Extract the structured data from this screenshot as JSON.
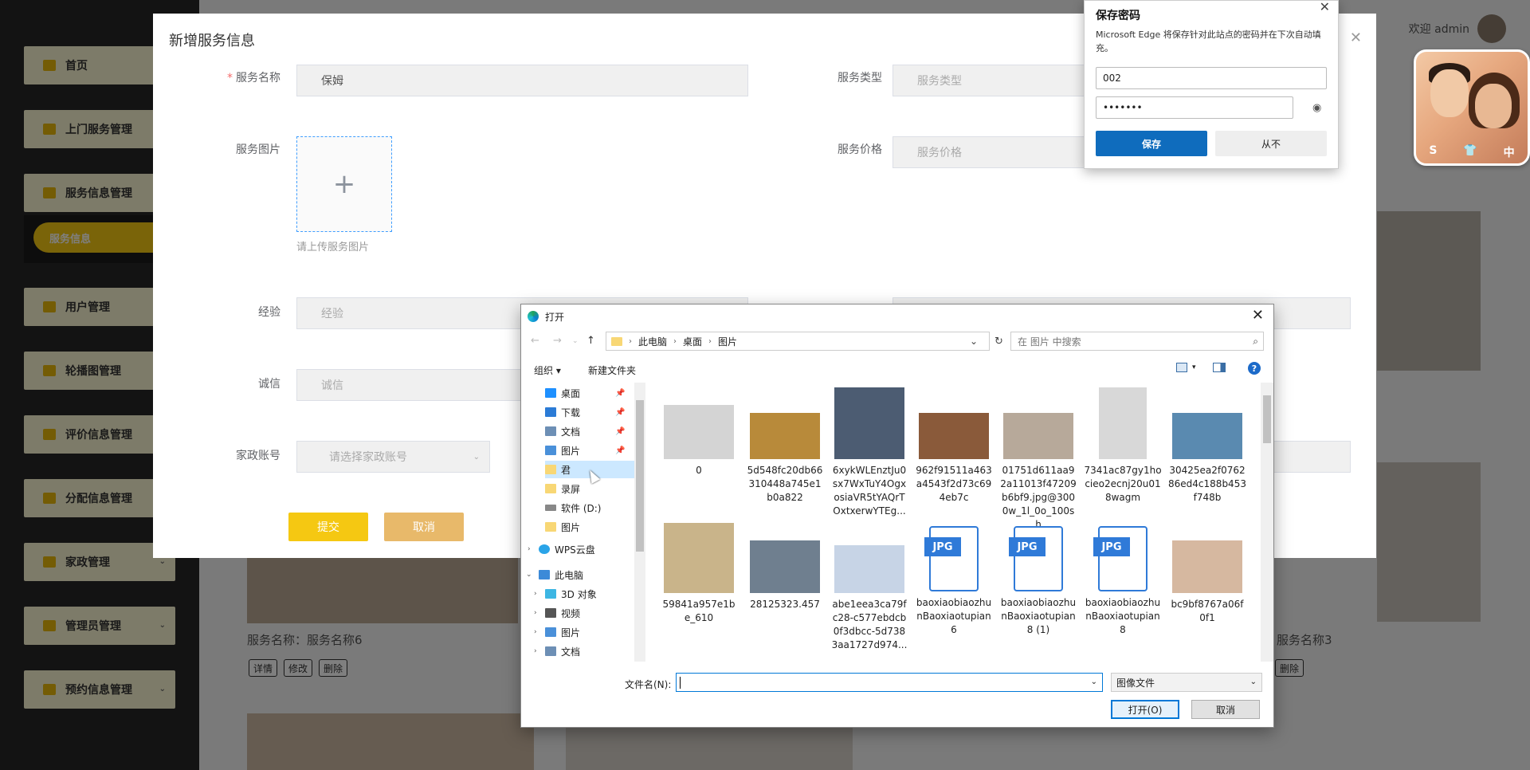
{
  "sidebar": {
    "items": [
      {
        "label": "首页",
        "top": 0
      },
      {
        "label": "上门服务管理"
      },
      {
        "label": "服务信息管理"
      },
      {
        "label": "用户管理"
      },
      {
        "label": "轮播图管理"
      },
      {
        "label": "评价信息管理"
      },
      {
        "label": "分配信息管理"
      },
      {
        "label": "家政管理"
      },
      {
        "label": "管理员管理"
      },
      {
        "label": "预约信息管理"
      }
    ],
    "submenu_active": "服务信息"
  },
  "topbar": {
    "welcome": "欢迎 admin"
  },
  "background_cards": [
    {
      "title": "服务名称：服务名称6",
      "buttons": [
        "详情",
        "修改",
        "删除"
      ]
    },
    {
      "title": "服务名称3",
      "buttons": [
        "删除"
      ]
    }
  ],
  "modal": {
    "title": "新增服务信息",
    "fields": {
      "service_name_label": "服务名称",
      "service_name_value": "保姆",
      "service_type_label": "服务类型",
      "service_type_placeholder": "服务类型",
      "service_image_label": "服务图片",
      "upload_tip": "请上传服务图片",
      "service_price_label": "服务价格",
      "service_price_placeholder": "服务价格",
      "experience_label": "经验",
      "experience_placeholder": "经验",
      "integrity_label": "诚信",
      "integrity_placeholder": "诚信",
      "housekeeping_label": "家政账号",
      "housekeeping_placeholder": "请选择家政账号"
    },
    "submit_label": "提交",
    "cancel_label": "取消"
  },
  "password_popup": {
    "title": "保存密码",
    "description": "Microsoft Edge 将保存针对此站点的密码并在下次自动填充。",
    "username": "002",
    "password_mask": "•••••••",
    "save_label": "保存",
    "never_label": "从不"
  },
  "profile_card": {
    "badges": [
      "S",
      "👕",
      "中"
    ]
  },
  "file_dialog": {
    "title": "打开",
    "breadcrumb": [
      "此电脑",
      "桌面",
      "图片"
    ],
    "search_placeholder": "在 图片 中搜索",
    "toolbar": {
      "organize": "组织 ▾",
      "new_folder": "新建文件夹"
    },
    "tree": [
      {
        "label": "桌面",
        "pinned": true,
        "icon_color": "#1e90ff"
      },
      {
        "label": "下载",
        "pinned": true,
        "icon_color": "#2b7bd6"
      },
      {
        "label": "文档",
        "pinned": true,
        "icon_color": "#6d8fb5"
      },
      {
        "label": "图片",
        "pinned": true,
        "icon_color": "#4a90d9"
      },
      {
        "label": "君",
        "pinned": false,
        "icon_color": "#f8d775"
      },
      {
        "label": "录屏",
        "pinned": false,
        "icon_color": "#f8d775"
      },
      {
        "label": "软件 (D:)",
        "pinned": false,
        "icon_color": "#888888"
      },
      {
        "label": "图片",
        "pinned": false,
        "icon_color": "#f8d775"
      },
      {
        "label": "WPS云盘",
        "pinned": false,
        "icon_color": "#2aa4e8"
      },
      {
        "label": "此电脑",
        "pinned": false,
        "icon_color": "#3c8ad8"
      },
      {
        "label": "3D 对象",
        "pinned": false,
        "icon_color": "#3db6e3"
      },
      {
        "label": "视频",
        "pinned": false,
        "icon_color": "#555555"
      },
      {
        "label": "图片",
        "pinned": false,
        "icon_color": "#4a90d9"
      },
      {
        "label": "文档",
        "pinned": false,
        "icon_color": "#6d8fb5"
      }
    ],
    "files": [
      {
        "name": "0",
        "kind": "photo",
        "color": "#c8c8c8"
      },
      {
        "name": "5d548fc20db66310448a745e1b0a822",
        "kind": "photo",
        "color": "#b88a3a"
      },
      {
        "name": "6xykWLEnztJu0sx7WxTuY4OgxosiaVR5tYAQrTOxtxerwYTEg...",
        "kind": "photo",
        "color": "#4c5c72"
      },
      {
        "name": "962f91511a463a4543f2d73c694eb7c",
        "kind": "photo",
        "color": "#8a5a3a"
      },
      {
        "name": "01751d611aa92a11013f47209b6bf9.jpg@3000w_1l_0o_100sh",
        "kind": "photo",
        "color": "#b7a99a"
      },
      {
        "name": "7341ac87gy1hocieo2ecnj20u018wagm",
        "kind": "photo",
        "color": "#d8d8d8"
      },
      {
        "name": "30425ea2f076286ed4c188b453f748b",
        "kind": "photo",
        "color": "#5a8ab0"
      },
      {
        "name": "59841a957e1be_610",
        "kind": "photo",
        "color": "#c9b48a"
      },
      {
        "name": "28125323.457",
        "kind": "photo",
        "color": "#6f7f8f"
      },
      {
        "name": "abe1eea3ca79fc28-c577ebdcb0f3dbcc-5d7383aa1727d974...",
        "kind": "photo",
        "color": "#c7d4e6"
      },
      {
        "name": "baoxiaobiaozhunBaoxiaotupian6",
        "kind": "jpg",
        "color": "#2f7ad8"
      },
      {
        "name": "baoxiaobiaozhunBaoxiaotupian8 (1)",
        "kind": "jpg",
        "color": "#2f7ad8"
      },
      {
        "name": "baoxiaobiaozhunBaoxiaotupian8",
        "kind": "jpg",
        "color": "#2f7ad8"
      },
      {
        "name": "bc9bf8767a06f0f1",
        "kind": "photo",
        "color": "#d6b8a0"
      }
    ],
    "filename_label": "文件名(N):",
    "filename_value": "",
    "filetype_value": "图像文件",
    "open_label": "打开(O)",
    "cancel_label": "取消"
  }
}
